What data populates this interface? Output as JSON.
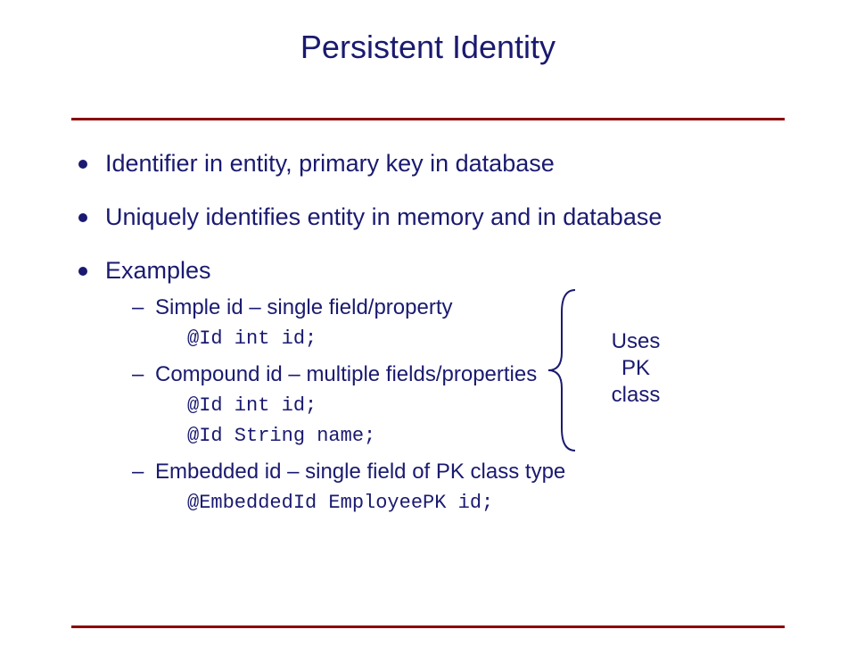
{
  "title": "Persistent Identity",
  "bullets": [
    {
      "text": "Identifier in entity, primary key in database"
    },
    {
      "text": "Uniquely identifies entity in memory and in database"
    },
    {
      "text": "Examples",
      "subs": [
        {
          "text": "Simple id – single field/property",
          "code": [
            "@Id int id;"
          ]
        },
        {
          "text": "Compound id – multiple fields/properties",
          "code": [
            "@Id int id;",
            "@Id String name;"
          ]
        },
        {
          "text": "Embedded id – single field of PK class type",
          "code": [
            "@EmbeddedId EmployeePK id;"
          ]
        }
      ]
    }
  ],
  "annotation": {
    "line1": "Uses",
    "line2": "PK",
    "line3": "class"
  }
}
